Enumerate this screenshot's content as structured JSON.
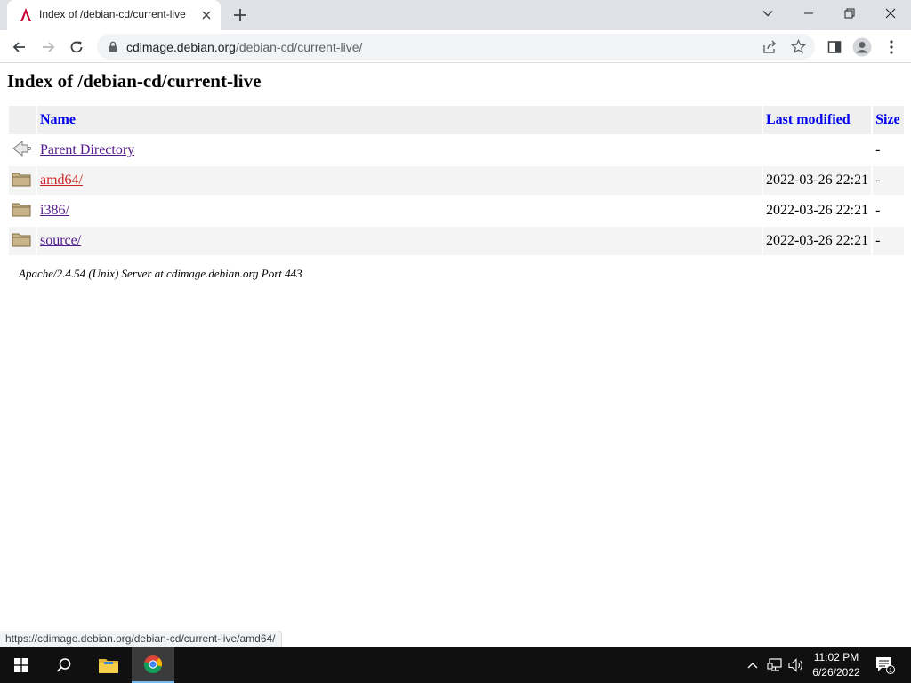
{
  "browser": {
    "tab": {
      "title": "Index of /debian-cd/current-live",
      "favicon": "debian-logo"
    },
    "address": {
      "host": "cdimage.debian.org",
      "path": "/debian-cd/current-live/"
    },
    "status_url": "https://cdimage.debian.org/debian-cd/current-live/amd64/",
    "accent": "#dee1e6"
  },
  "page": {
    "title": "Index of /debian-cd/current-live",
    "columns": {
      "name": "Name",
      "last_modified": "Last modified",
      "size": "Size"
    },
    "rows": [
      {
        "icon": "parent-directory-icon",
        "name": "Parent Directory",
        "modified": "",
        "size": "-"
      },
      {
        "icon": "folder-icon",
        "name": "amd64/",
        "modified": "2022-03-26 22:21",
        "size": "-"
      },
      {
        "icon": "folder-icon",
        "name": "i386/",
        "modified": "2022-03-26 22:21",
        "size": "-"
      },
      {
        "icon": "folder-icon",
        "name": "source/",
        "modified": "2022-03-26 22:21",
        "size": "-"
      }
    ],
    "footer": "Apache/2.4.54 (Unix) Server at cdimage.debian.org Port 443",
    "link_color": "#0000ee",
    "hover_link_color": "#cc2222"
  },
  "taskbar": {
    "time": "11:02 PM",
    "date": "6/26/2022",
    "notification_count": "1",
    "background": "#101010"
  }
}
